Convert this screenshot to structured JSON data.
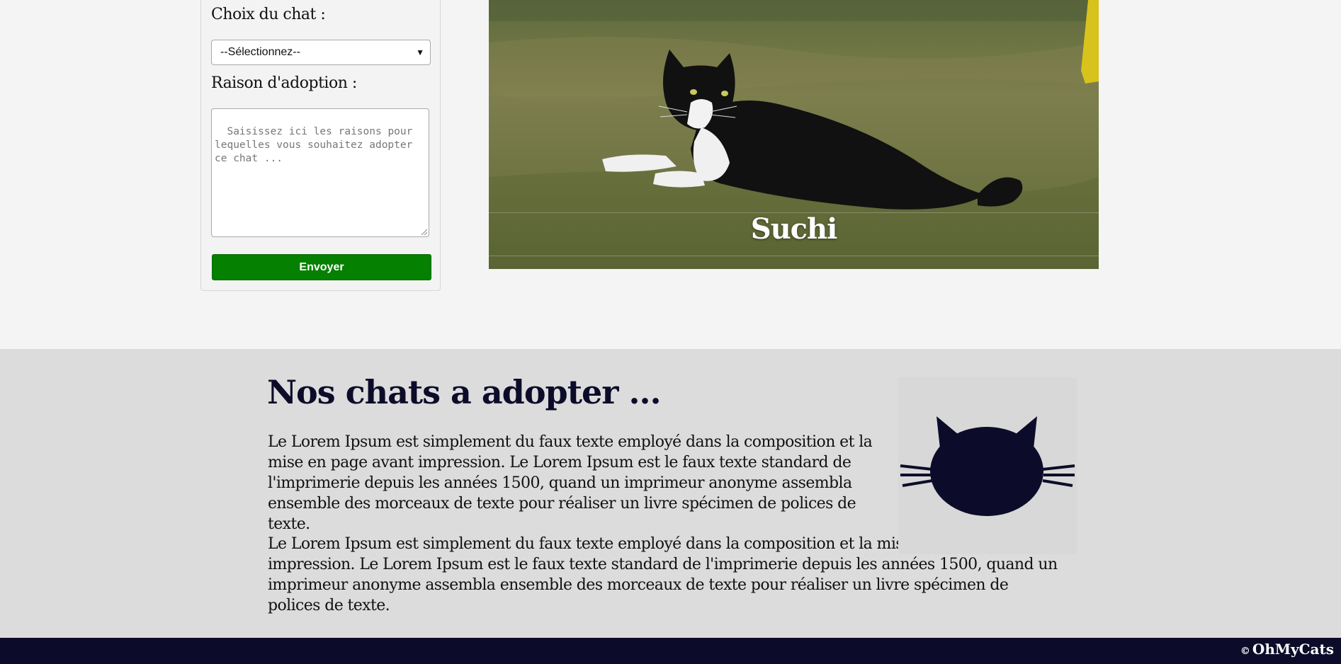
{
  "form": {
    "cat_choice_label": "Choix du chat :",
    "cat_select_value": "--Sélectionnez--",
    "reason_label": "Raison d'adoption :",
    "reason_placeholder": "Saisissez ici les raisons pour lequelles vous souhaitez adopter ce chat ...",
    "submit_label": "Envoyer"
  },
  "featured_cat": {
    "name": "Suchi"
  },
  "adoption_section": {
    "title": "Nos chats a adopter ...",
    "paragraph_1": "Le Lorem Ipsum est simplement du faux texte employé dans la composition et la mise en page avant impression. Le Lorem Ipsum est le faux texte standard de l'imprimerie depuis les années 1500, quand un imprimeur anonyme assembla ensemble des morceaux de texte pour réaliser un livre spécimen de polices de texte.",
    "paragraph_2": "Le Lorem Ipsum est simplement du faux texte employé dans la composition et la mise en page avant impression. Le Lorem Ipsum est le faux texte standard de l'imprimerie depuis les années 1500, quand un imprimeur anonyme assembla ensemble des morceaux de texte pour réaliser un livre spécimen de polices de texte.",
    "icon": "cat-head-icon"
  },
  "footer": {
    "copyright_symbol": "©",
    "brand": "OhMyCats"
  },
  "colors": {
    "primary_navy": "#0c0c2a",
    "submit_green": "#058000",
    "page_background": "#f4f4f4",
    "section_background": "#dcdcdc"
  }
}
